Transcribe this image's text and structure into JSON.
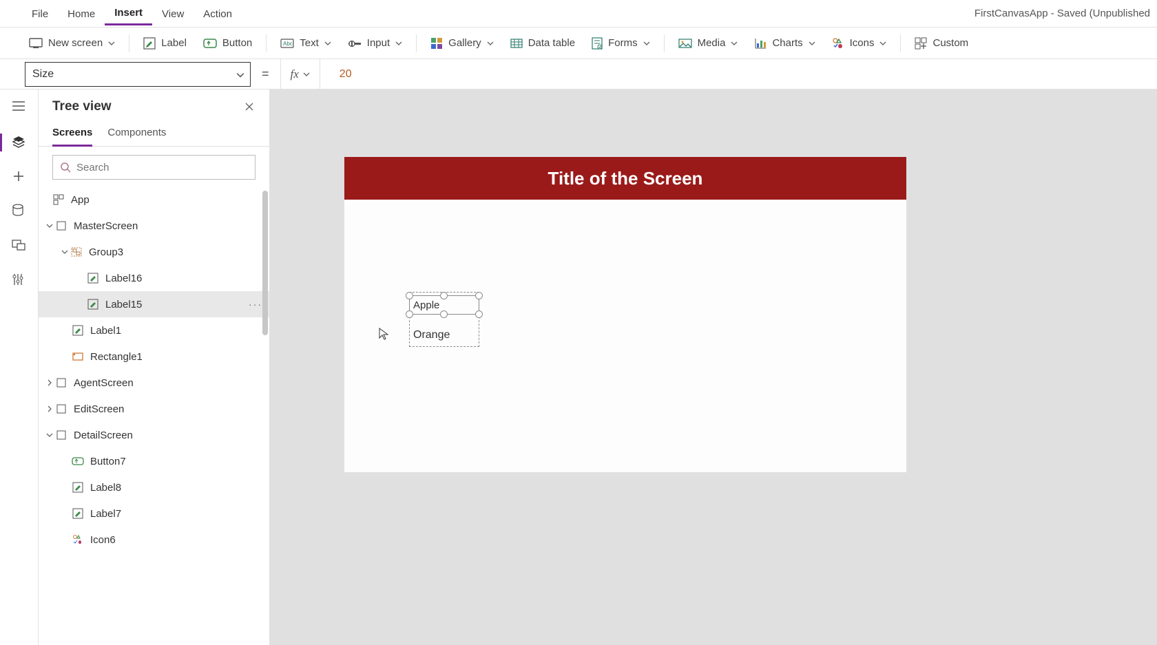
{
  "menu": {
    "items": [
      "File",
      "Home",
      "Insert",
      "View",
      "Action"
    ],
    "active": "Insert",
    "app_title": "FirstCanvasApp - Saved (Unpublished"
  },
  "ribbon": {
    "new_screen": "New screen",
    "label": "Label",
    "button": "Button",
    "text": "Text",
    "input": "Input",
    "gallery": "Gallery",
    "data_table": "Data table",
    "forms": "Forms",
    "media": "Media",
    "charts": "Charts",
    "icons": "Icons",
    "custom": "Custom"
  },
  "formula": {
    "property": "Size",
    "value": "20"
  },
  "tree": {
    "title": "Tree view",
    "tabs": {
      "screens": "Screens",
      "components": "Components"
    },
    "search_placeholder": "Search",
    "app": "App",
    "nodes": {
      "masterscreen": "MasterScreen",
      "group3": "Group3",
      "label16": "Label16",
      "label15": "Label15",
      "label1": "Label1",
      "rectangle1": "Rectangle1",
      "agentscreen": "AgentScreen",
      "editscreen": "EditScreen",
      "detailscreen": "DetailScreen",
      "button7": "Button7",
      "label8": "Label8",
      "label7": "Label7",
      "icon6": "Icon6"
    }
  },
  "canvas": {
    "title": "Title of the Screen",
    "label15_text": "Apple",
    "label16_text": "Orange"
  }
}
